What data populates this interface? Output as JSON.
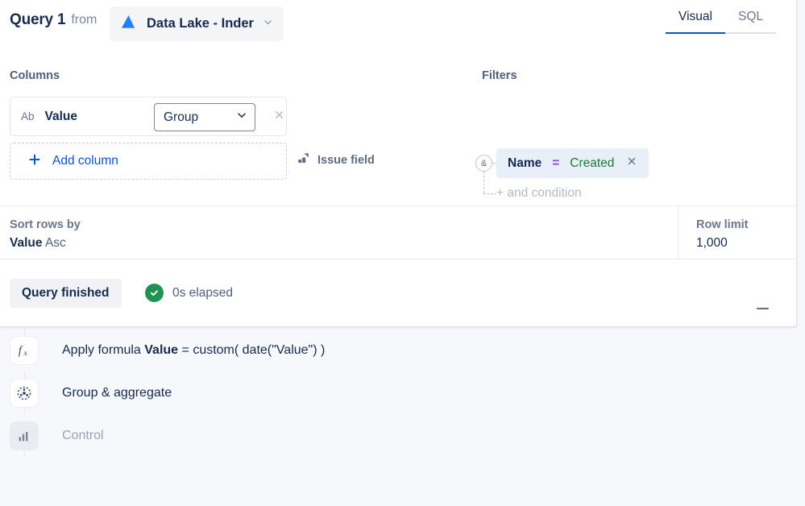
{
  "header": {
    "query_title": "Query 1",
    "from_label": "from",
    "source_name": "Data Lake - Inder",
    "source_icon": "atlassian-logo-icon",
    "source_chevron": "chevron-down-icon",
    "tabs": [
      {
        "label": "Visual",
        "active": true
      },
      {
        "label": "SQL",
        "active": false
      }
    ]
  },
  "builder": {
    "columns": {
      "label": "Columns",
      "chip": {
        "type_icon": "Ab",
        "name": "Value",
        "select_value": "Group",
        "select_chevron": "chevron-down-icon",
        "clear_icon": "close-icon"
      },
      "issue_field": {
        "label": "Issue field",
        "icon": "issue-field-icon"
      },
      "add_column": {
        "label": "Add column",
        "icon": "plus-icon"
      }
    },
    "filters": {
      "label": "Filters",
      "connector": "&",
      "chip": {
        "field": "Name",
        "operator": "=",
        "value": "Created",
        "remove_icon": "close-icon"
      },
      "add_condition": "+ and condition"
    }
  },
  "sort": {
    "title": "Sort rows by",
    "field": "Value",
    "direction": "Asc"
  },
  "row_limit": {
    "title": "Row limit",
    "value": "1,000"
  },
  "status": {
    "pill_label": "Query finished",
    "status_icon": "check-circle-icon",
    "elapsed": "0s elapsed",
    "collapse_icon": "minus-icon"
  },
  "steps": [
    {
      "icon": "function-fx-icon",
      "label_prefix": "Apply formula ",
      "label_bold": "Value",
      "label_suffix": " = custom( date(\"Value\") )",
      "disabled": false
    },
    {
      "icon": "group-aggregate-icon",
      "label_prefix": "Group & aggregate",
      "label_bold": "",
      "label_suffix": "",
      "disabled": false
    },
    {
      "icon": "bar-chart-icon",
      "label_prefix": "Control",
      "label_bold": "",
      "label_suffix": "",
      "disabled": true
    }
  ],
  "colors": {
    "accent_blue": "#0c54c9",
    "success_green": "#1f9254",
    "operator_purple": "#8b46c9",
    "value_green": "#1e7b34",
    "text_primary": "#172b4d",
    "text_muted": "#6b778c"
  }
}
